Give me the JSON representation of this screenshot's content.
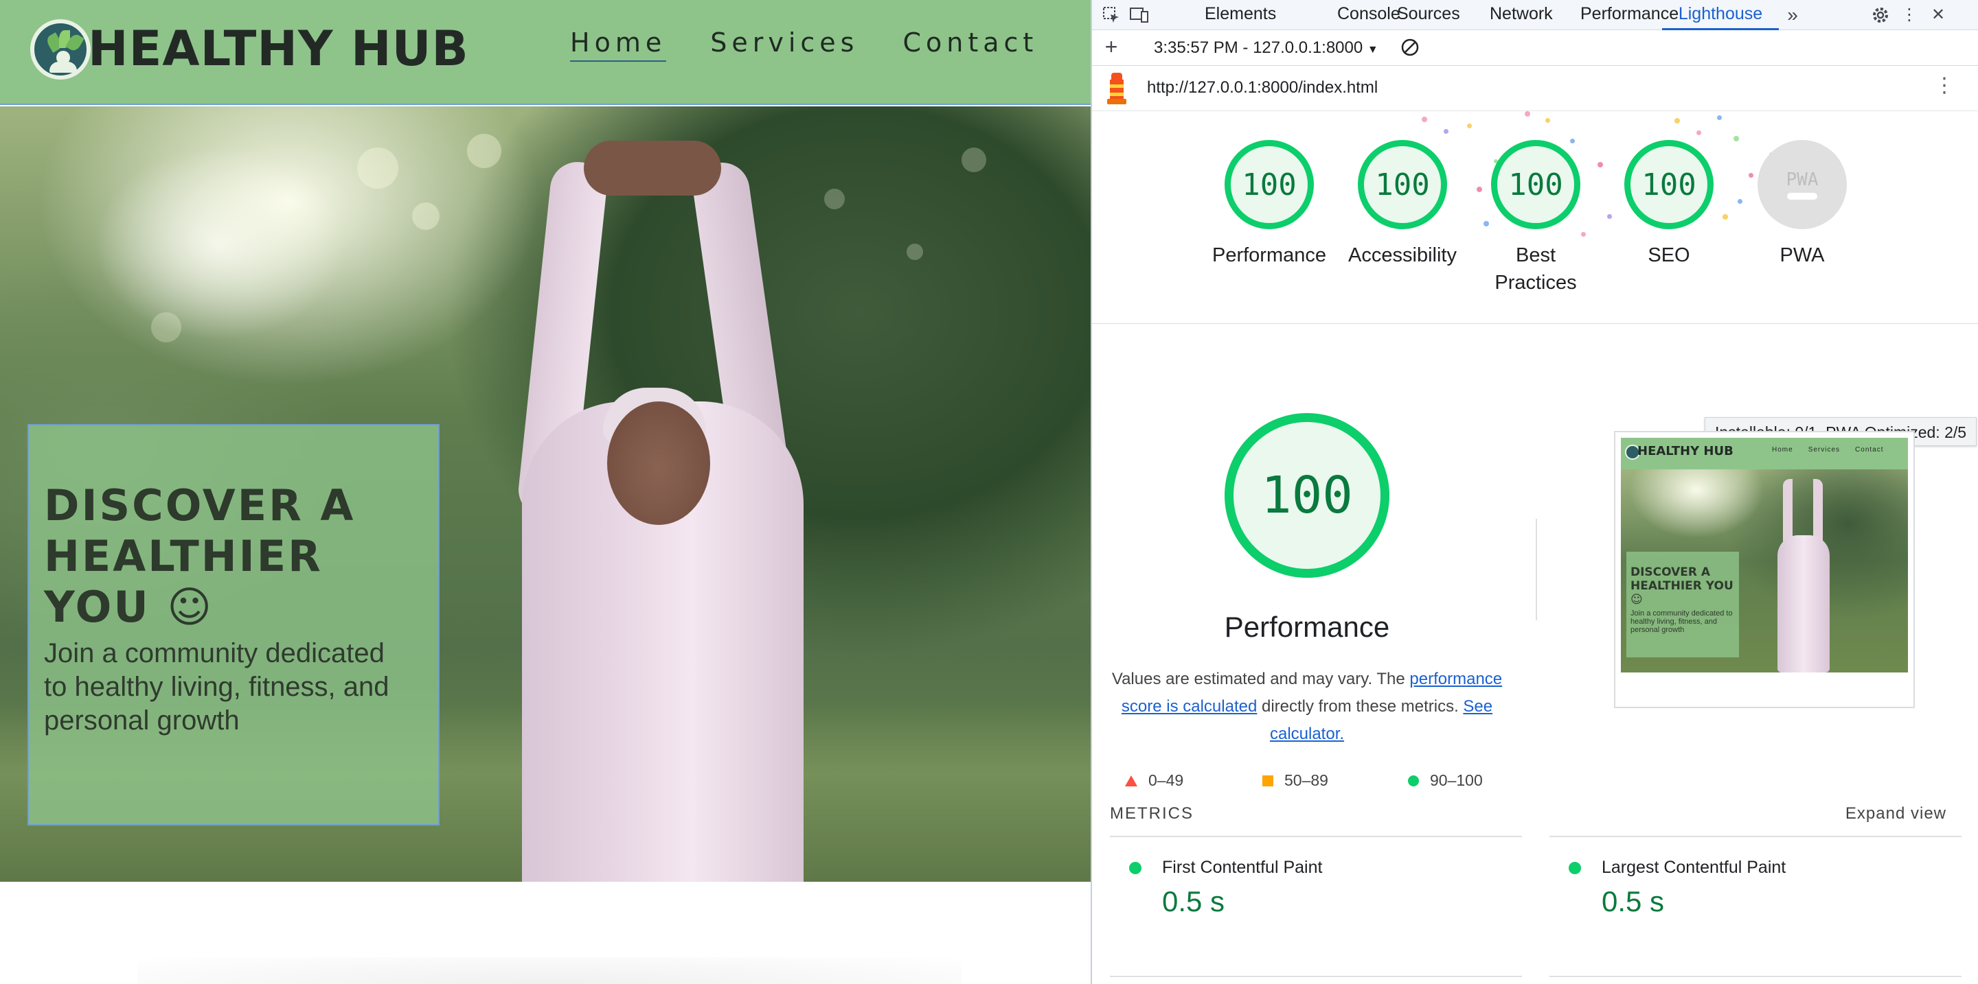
{
  "site": {
    "brand": "HEALTHY HUB",
    "nav": [
      "Home",
      "Services",
      "Contact"
    ],
    "active_nav": "Home",
    "hero_title": "DISCOVER A HEALTHIER YOU ☺",
    "hero_text": "Join a community dedicated to healthy living, fitness, and personal growth"
  },
  "devtools": {
    "tabs": [
      "Elements",
      "Console",
      "Sources",
      "Network",
      "Performance",
      "Lighthouse"
    ],
    "active_tab": "Lighthouse",
    "more_tabs_icon": "chevron-double-right-icon",
    "report_select": "3:35:57 PM - 127.0.0.1:8000",
    "url": "http://127.0.0.1:8000/index.html",
    "gauges": [
      {
        "label": "Performance",
        "score": "100"
      },
      {
        "label": "Accessibility",
        "score": "100"
      },
      {
        "label": "Best Practices",
        "score": "100"
      },
      {
        "label": "SEO",
        "score": "100"
      },
      {
        "label": "PWA",
        "score": "PWA"
      }
    ],
    "pwa_tooltip": "Installable: 0/1, PWA Optimized: 2/5",
    "performance": {
      "score": "100",
      "title": "Performance",
      "desc_prefix": "Values are estimated and may vary. The ",
      "desc_link1": "performance score is calculated",
      "desc_middle": " directly from these metrics. ",
      "desc_link2": "See calculator."
    },
    "legend": [
      {
        "range": "0–49",
        "color": "#ff4e42",
        "shape": "triangle"
      },
      {
        "range": "50–89",
        "color": "#ffa400",
        "shape": "square"
      },
      {
        "range": "90–100",
        "color": "#0cce6b",
        "shape": "circle"
      }
    ],
    "metrics_heading": "METRICS",
    "expand_label": "Expand view",
    "metrics": [
      {
        "name": "First Contentful Paint",
        "value": "0.5 s"
      },
      {
        "name": "Largest Contentful Paint",
        "value": "0.5 s"
      }
    ],
    "thumbnail": {
      "brand": "HEALTHY HUB",
      "nav": [
        "Home",
        "Services",
        "Contact"
      ],
      "title": "DISCOVER A HEALTHIER YOU ☺",
      "text": "Join a community dedicated to healthy living, fitness, and personal growth"
    }
  },
  "colors": {
    "site_green": "#8ec48a",
    "score_green": "#0cce6b",
    "score_text": "#0a7a3e",
    "devtools_accent": "#1a61cf"
  }
}
